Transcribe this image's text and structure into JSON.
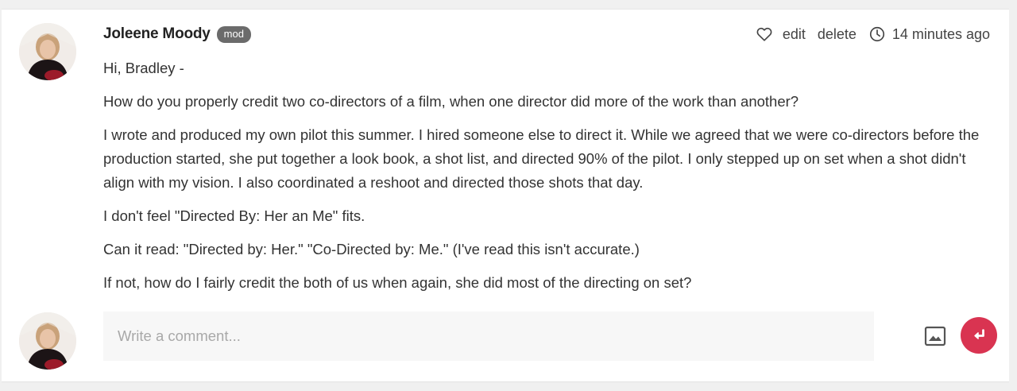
{
  "post": {
    "author": "Joleene Moody",
    "badge": "mod",
    "actions": {
      "edit": "edit",
      "delete": "delete"
    },
    "timestamp": "14 minutes ago",
    "paragraphs": [
      "Hi, Bradley -",
      "How do you properly credit two co-directors of a film, when one director did more of the work than another?",
      "I wrote and produced my own pilot this summer. I hired someone else to direct it. While we agreed that we were co-directors before the production started, she put together a look book, a shot list, and directed 90% of the pilot. I only stepped up on set when a shot didn't align with my vision. I also coordinated a reshoot and directed those shots that day.",
      "I don't feel \"Directed By: Her an Me\" fits.",
      "Can it read: \"Directed by: Her.\" \"Co-Directed by: Me.\" (I've read this isn't accurate.)",
      "If not, how do I fairly credit the both of us when again, she did most of the directing on set?"
    ]
  },
  "comment": {
    "placeholder": "Write a comment...",
    "value": ""
  },
  "icons": {
    "like": "heart-icon",
    "time": "clock-icon",
    "attach": "image-icon",
    "send": "enter-arrow-icon"
  },
  "colors": {
    "send_button": "#d93451",
    "badge": "#6b6b6b",
    "text": "#333333",
    "input_bg": "#f7f7f7"
  }
}
